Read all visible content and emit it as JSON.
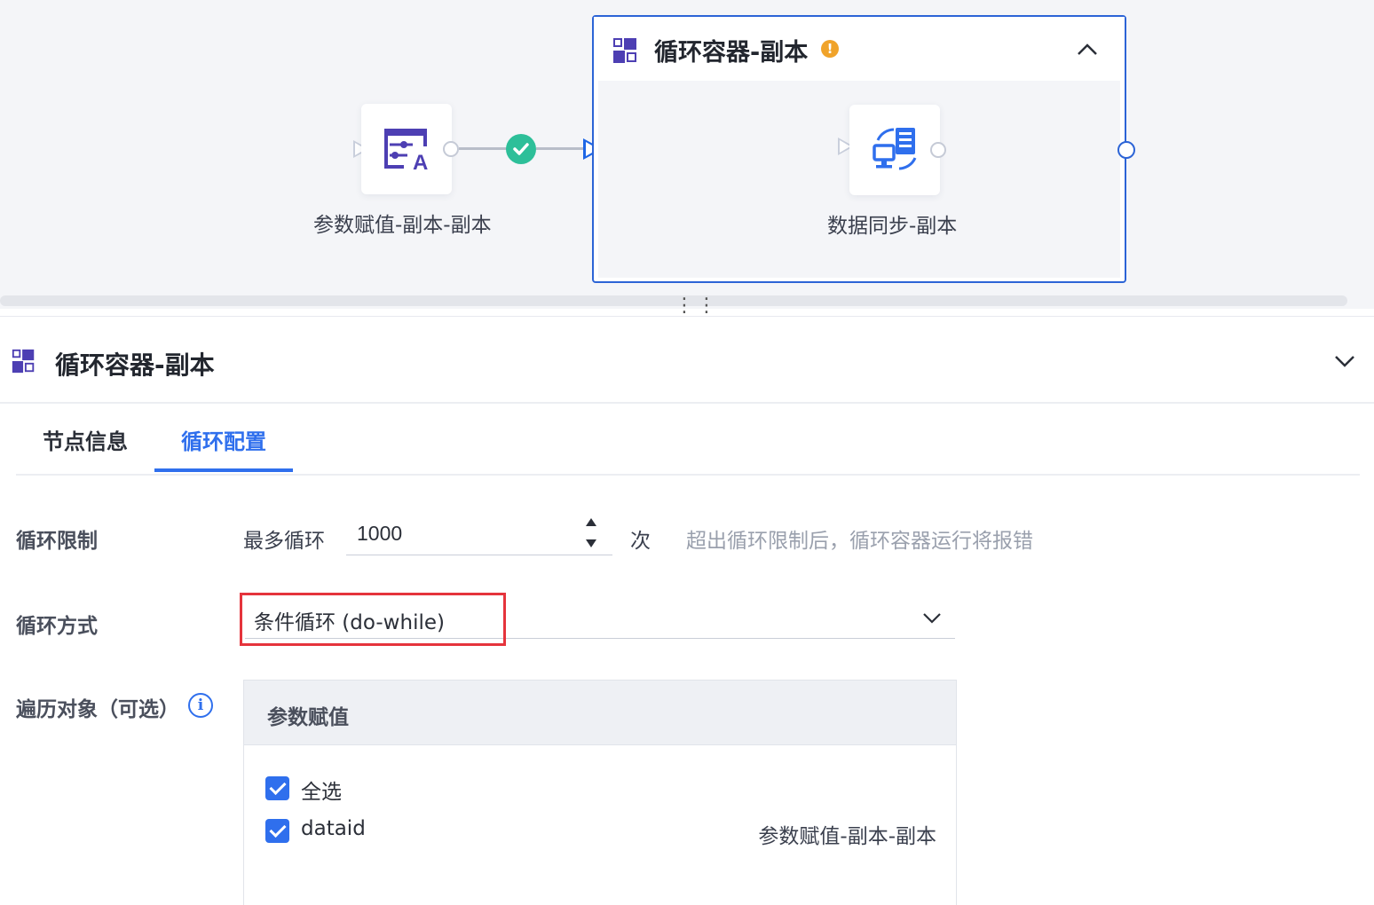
{
  "canvas": {
    "node_param": {
      "label": "参数赋值-副本-副本",
      "icon": "param-assign-icon"
    },
    "container": {
      "title": "循环容器-副本",
      "warning_glyph": "!",
      "icon": "loop-container-icon",
      "collapse_icon": "chevron-up-icon"
    },
    "node_sync": {
      "label": "数据同步-副本",
      "icon": "data-sync-icon"
    },
    "edge_status": "success",
    "grip": "⋮⋮"
  },
  "panel": {
    "title": "循环容器-副本",
    "collapse_icon": "chevron-down-icon",
    "tabs": [
      {
        "label": "节点信息",
        "active": false
      },
      {
        "label": "循环配置",
        "active": true
      }
    ]
  },
  "form": {
    "loop_limit": {
      "label": "循环限制",
      "prefix": "最多循环",
      "value": "1000",
      "unit": "次",
      "hint": "超出循环限制后，循环容器运行将报错"
    },
    "loop_mode": {
      "label": "循环方式",
      "value": "条件循环 (do-while)"
    },
    "iterate": {
      "label": "遍历对象（可选）",
      "info_glyph": "i",
      "table_header": "参数赋值",
      "rows": [
        {
          "label": "全选",
          "checked": true,
          "source": ""
        },
        {
          "label": "dataid",
          "checked": true,
          "source": "参数赋值-副本-副本"
        }
      ]
    }
  },
  "colors": {
    "accent": "#2f6fed",
    "container_border": "#2c64d6",
    "icon_purple": "#4d3fb3",
    "success": "#2dbf99",
    "warning": "#f0a32a",
    "highlight": "#e5343c"
  }
}
